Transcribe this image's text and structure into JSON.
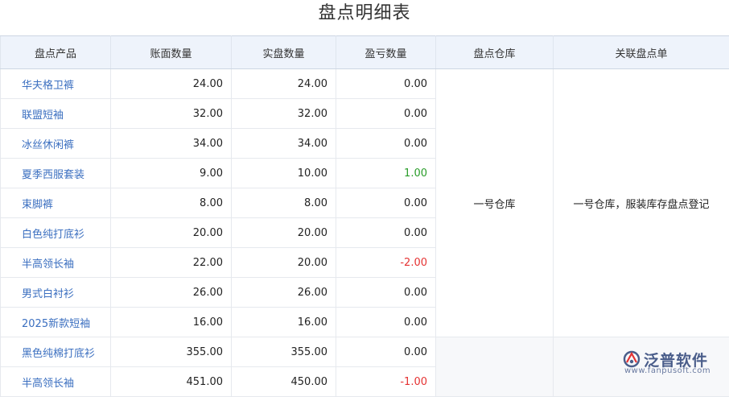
{
  "title": "盘点明细表",
  "headers": [
    "盘点产品",
    "账面数量",
    "实盘数量",
    "盈亏数量",
    "盘点仓库",
    "关联盘点单"
  ],
  "rows": [
    {
      "product": "华夫格卫裤",
      "book": "24.00",
      "actual": "24.00",
      "diff": "0.00",
      "diff_tone": "normal"
    },
    {
      "product": "联盟短袖",
      "book": "32.00",
      "actual": "32.00",
      "diff": "0.00",
      "diff_tone": "normal"
    },
    {
      "product": "冰丝休闲裤",
      "book": "34.00",
      "actual": "34.00",
      "diff": "0.00",
      "diff_tone": "normal"
    },
    {
      "product": "夏季西服套装",
      "book": "9.00",
      "actual": "10.00",
      "diff": "1.00",
      "diff_tone": "positive"
    },
    {
      "product": "束脚裤",
      "book": "8.00",
      "actual": "8.00",
      "diff": "0.00",
      "diff_tone": "normal"
    },
    {
      "product": "白色纯打底衫",
      "book": "20.00",
      "actual": "20.00",
      "diff": "0.00",
      "diff_tone": "normal"
    },
    {
      "product": "半高领长袖",
      "book": "22.00",
      "actual": "20.00",
      "diff": "-2.00",
      "diff_tone": "negative"
    },
    {
      "product": "男式白衬衫",
      "book": "26.00",
      "actual": "26.00",
      "diff": "0.00",
      "diff_tone": "normal"
    },
    {
      "product": "2025新款短袖",
      "book": "16.00",
      "actual": "16.00",
      "diff": "0.00",
      "diff_tone": "normal"
    },
    {
      "product": "黑色纯棉打底衫",
      "book": "355.00",
      "actual": "355.00",
      "diff": "0.00",
      "diff_tone": "normal"
    },
    {
      "product": "半高领长袖",
      "book": "451.00",
      "actual": "450.00",
      "diff": "-1.00",
      "diff_tone": "negative"
    }
  ],
  "group1": {
    "warehouse": "一号仓库",
    "order": "一号仓库，服装库存盘点登记"
  },
  "colors": {
    "link": "#3b6fc0",
    "positive": "#2a9d2a",
    "negative": "#e53333",
    "header_bg": "#eef3fb"
  },
  "logo": {
    "icon": "fanpu-logo-icon",
    "text": "泛普软件",
    "url": "www.fanpusoft.com"
  }
}
